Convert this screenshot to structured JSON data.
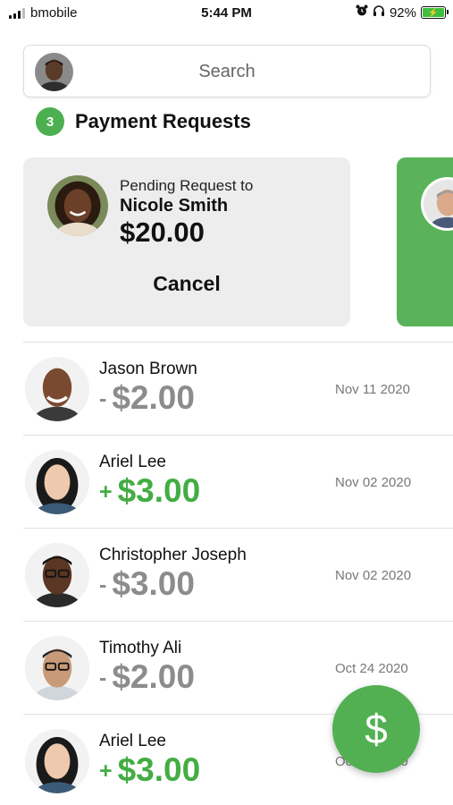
{
  "status_bar": {
    "carrier": "bmobile",
    "time": "5:44 PM",
    "battery": "92%"
  },
  "search": {
    "placeholder": "Search"
  },
  "payment_requests": {
    "count": "3",
    "title": "Payment Requests",
    "pending": {
      "label": "Pending Request to",
      "name": "Nicole Smith",
      "amount": "$20.00",
      "cancel_label": "Cancel"
    }
  },
  "transactions": [
    {
      "name": "Jason Brown",
      "sign": "-",
      "amount": "$2.00",
      "date": "Nov 11 2020",
      "type": "debit"
    },
    {
      "name": "Ariel Lee",
      "sign": "+",
      "amount": "$3.00",
      "date": "Nov 02 2020",
      "type": "credit"
    },
    {
      "name": "Christopher Joseph",
      "sign": "-",
      "amount": "$3.00",
      "date": "Nov 02 2020",
      "type": "debit"
    },
    {
      "name": "Timothy Ali",
      "sign": "-",
      "amount": "$2.00",
      "date": "Oct 24 2020",
      "type": "debit"
    },
    {
      "name": "Ariel Lee",
      "sign": "+",
      "amount": "$3.00",
      "date": "Oct 24 2020",
      "type": "credit"
    }
  ],
  "fab": {
    "label": "$"
  },
  "colors": {
    "accent": "#4caf50",
    "credit": "#43ad43",
    "debit": "#8c8c8c",
    "card_bg": "#ededed"
  },
  "icons": {
    "fab": "dollar-icon",
    "battery": "battery-charging-icon",
    "alarm": "alarm-icon",
    "headphones": "headphones-icon",
    "signal": "signal-icon"
  }
}
